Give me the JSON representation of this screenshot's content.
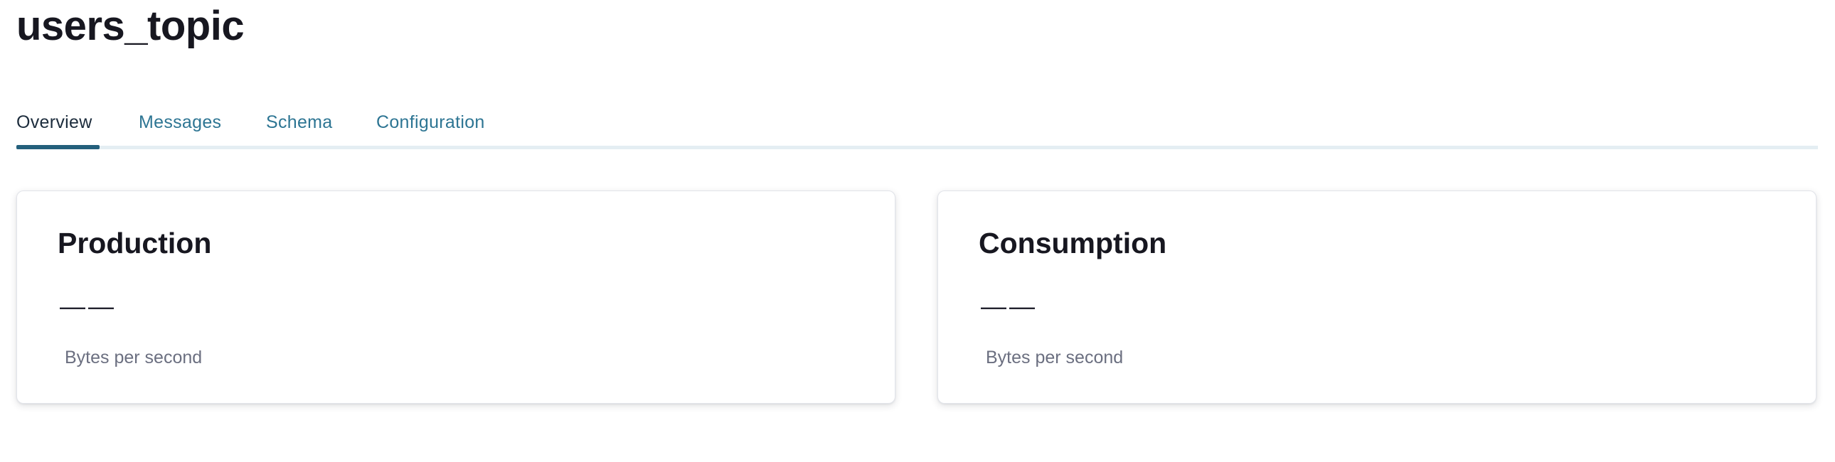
{
  "page": {
    "title": "users_topic"
  },
  "tabs": [
    {
      "label": "Overview",
      "active": true
    },
    {
      "label": "Messages",
      "active": false
    },
    {
      "label": "Schema",
      "active": false
    },
    {
      "label": "Configuration",
      "active": false
    }
  ],
  "cards": {
    "production": {
      "title": "Production",
      "value": "——",
      "unit": "Bytes per second"
    },
    "consumption": {
      "title": "Consumption",
      "value": "——",
      "unit": "Bytes per second"
    }
  },
  "colors": {
    "tab_link": "#2d7593",
    "tab_active_text": "#1c2c3c",
    "tab_indicator": "#24607c",
    "tab_track": "#e4eef3",
    "muted_text": "#6b6f80"
  }
}
